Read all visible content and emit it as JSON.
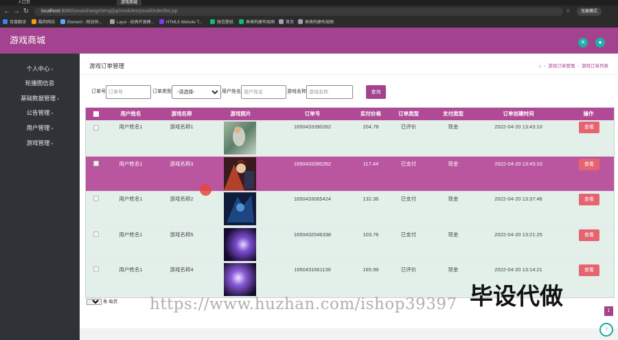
{
  "browser": {
    "tabs": [
      "人口页",
      "游戏商城"
    ],
    "url_host": "localhost",
    "url_path": ":8080/youxishangcheng/jsp/modules/youxiOrder/list.jsp",
    "profile": "无痕模式",
    "bookmarks": [
      "百度翻译",
      "酷狗网站",
      "Element - 网站快...",
      "Layui - 经典开源模...",
      "HTML5 Website T...",
      "微信壁纸",
      "表格构建布局图",
      "首页",
      "表格构建布局图"
    ]
  },
  "app": {
    "title": "游戏商城",
    "header_icons": [
      "expand-icon",
      "user-icon"
    ]
  },
  "sidebar": {
    "items": [
      {
        "label": "个人中心"
      },
      {
        "label": "轮播图信息"
      },
      {
        "label": "基础数据管理"
      },
      {
        "label": "公告管理"
      },
      {
        "label": "用户管理"
      },
      {
        "label": "游戏管理"
      }
    ]
  },
  "page": {
    "title": "游戏订单管理",
    "breadcrumb": [
      "游戏订单管理",
      "游戏订单列表"
    ]
  },
  "search": {
    "order_no_label": "订单号",
    "order_no_placeholder": "订单号",
    "order_type_label": "订单类型",
    "order_type_selected": "-请选择-",
    "user_name_label": "用户姓名",
    "user_name_placeholder": "用户姓名",
    "game_name_label": "游戏名称",
    "game_name_placeholder": "游戏名称",
    "button": "查询"
  },
  "table": {
    "headers": [
      "用户姓名",
      "游戏名称",
      "游戏照片",
      "订单号",
      "实付价格",
      "订单类型",
      "支付类型",
      "订单创建时间",
      "操作"
    ],
    "rows": [
      {
        "user": "用户姓名1",
        "game": "游戏名称1",
        "order_no": "1650433390262",
        "price": "204.78",
        "type": "已评价",
        "pay": "现金",
        "time": "2022-04-20 13:43:10",
        "action": "查看"
      },
      {
        "user": "用户姓名1",
        "game": "游戏名称3",
        "order_no": "1650433390262",
        "price": "117.44",
        "type": "已支付",
        "pay": "现金",
        "time": "2022-04-20 13:43:10",
        "action": "查看"
      },
      {
        "user": "用户姓名1",
        "game": "游戏名称2",
        "order_no": "1650433065424",
        "price": "132.36",
        "type": "已支付",
        "pay": "现金",
        "time": "2022-04-20 13:37:46",
        "action": "查看"
      },
      {
        "user": "用户姓名1",
        "game": "游戏名称5",
        "order_no": "1650432046338",
        "price": "103.76",
        "type": "已支付",
        "pay": "现金",
        "time": "2022-04-20 13:21:25",
        "action": "查看"
      },
      {
        "user": "用户姓名1",
        "game": "游戏名称4",
        "order_no": "1650431661139",
        "price": "165.99",
        "type": "已评价",
        "pay": "现金",
        "time": "2022-04-20 13:14:21",
        "action": "查看"
      }
    ]
  },
  "pager": {
    "page_size": "10",
    "per_page_label": "条 每页",
    "current_page": "1"
  },
  "watermark": {
    "url": "https://www.huzhan.com/ishop39397",
    "text": "毕设代做"
  },
  "colors": {
    "brand": "#a3428e",
    "header_icon": "#1fb1a8",
    "view_button": "#e56470",
    "row_bg": "#e3f0ea",
    "sidebar_bg": "#2f3338"
  }
}
